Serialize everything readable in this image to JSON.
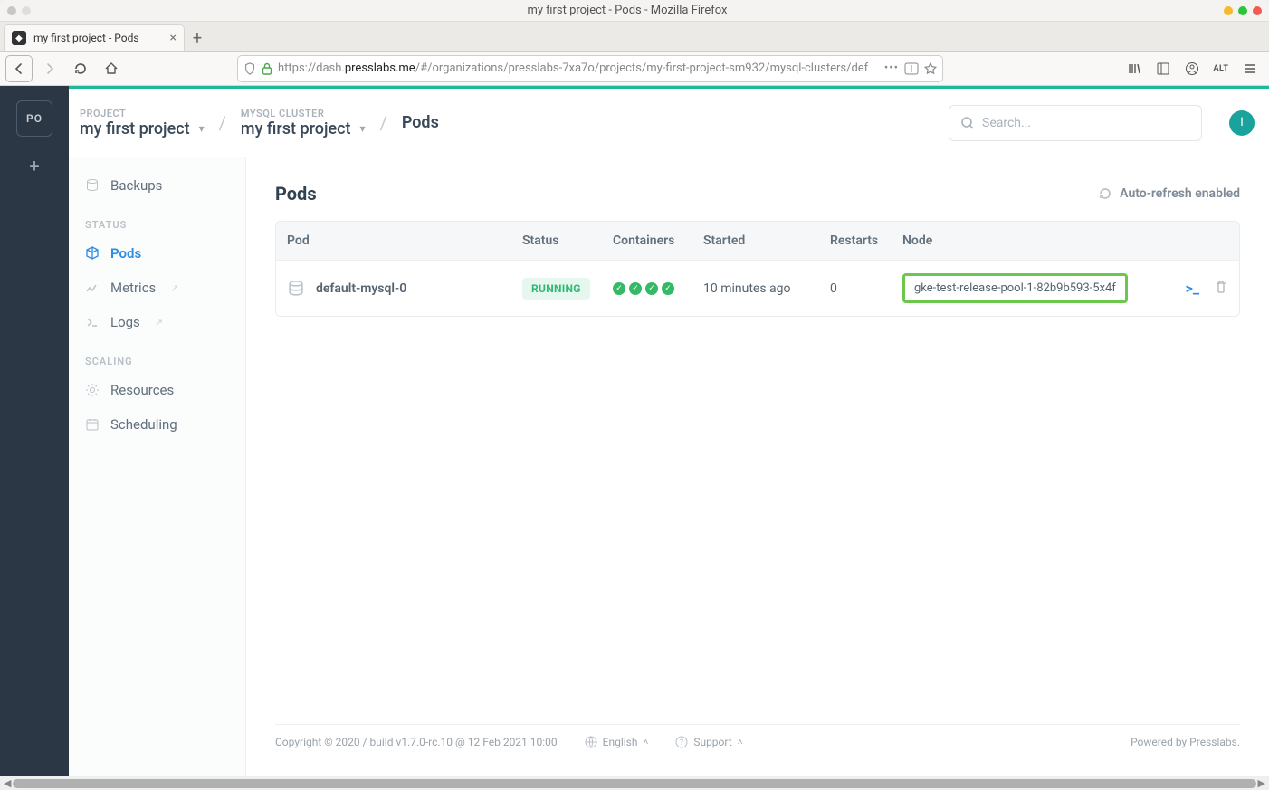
{
  "os": {
    "title": "my first project - Pods - Mozilla Firefox"
  },
  "browser": {
    "tab_title": "my first project - Pods",
    "url_prefix": "https://dash.",
    "url_host": "presslabs.me",
    "url_path": "/#/organizations/presslabs-7xa7o/projects/my-first-project-sm932/mysql-clusters/def"
  },
  "rail": {
    "org_initials": "PO"
  },
  "breadcrumb": {
    "project_label": "PROJECT",
    "project_name": "my first project",
    "cluster_label": "MYSQL CLUSTER",
    "cluster_name": "my first project",
    "page": "Pods"
  },
  "search": {
    "placeholder": "Search..."
  },
  "avatar_initial": "I",
  "sidebar": {
    "items": [
      {
        "label": "Backups"
      },
      {
        "label": "Pods"
      },
      {
        "label": "Metrics"
      },
      {
        "label": "Logs"
      },
      {
        "label": "Resources"
      },
      {
        "label": "Scheduling"
      }
    ],
    "status_head": "STATUS",
    "scaling_head": "SCALING"
  },
  "page": {
    "title": "Pods",
    "auto_refresh": "Auto-refresh enabled"
  },
  "table": {
    "headers": {
      "pod": "Pod",
      "status": "Status",
      "containers": "Containers",
      "started": "Started",
      "restarts": "Restarts",
      "node": "Node"
    },
    "row": {
      "name": "default-mysql-0",
      "status": "RUNNING",
      "started": "10 minutes ago",
      "restarts": "0",
      "node": "gke-test-release-pool-1-82b9b593-5x4f"
    }
  },
  "footer": {
    "copyright": "Copyright © 2020 / build v1.7.0-rc.10 @ 12 Feb 2021 10:00",
    "language": "English",
    "support": "Support",
    "powered": "Powered by Presslabs."
  }
}
